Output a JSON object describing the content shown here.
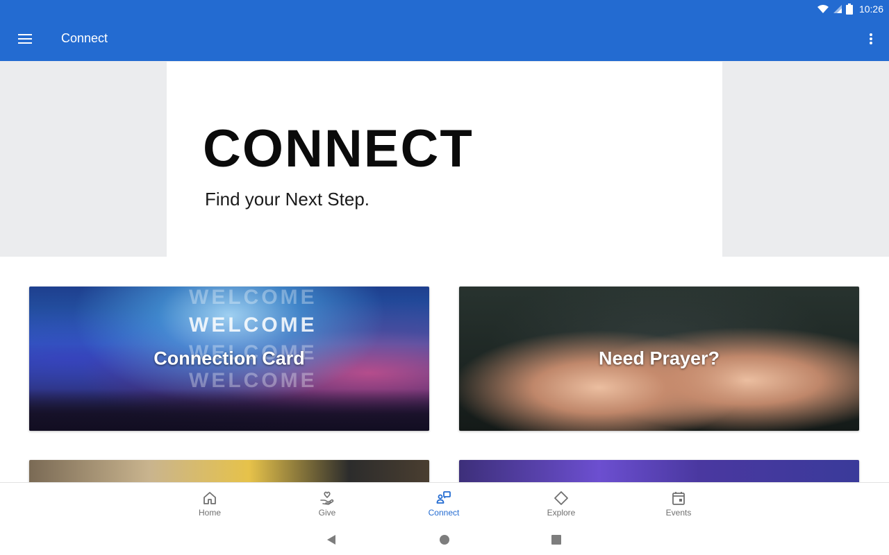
{
  "status_bar": {
    "time": "10:26"
  },
  "app_bar": {
    "title": "Connect"
  },
  "hero": {
    "title": "CONNECT",
    "subtitle": "Find your Next Step."
  },
  "tiles": [
    {
      "label": "Connection Card",
      "image_text": "WELCOME"
    },
    {
      "label": "Need Prayer?"
    }
  ],
  "bottom_nav": {
    "items": [
      {
        "label": "Home",
        "icon": "home-icon"
      },
      {
        "label": "Give",
        "icon": "give-icon"
      },
      {
        "label": "Connect",
        "icon": "connect-icon",
        "active": true
      },
      {
        "label": "Explore",
        "icon": "explore-icon"
      },
      {
        "label": "Events",
        "icon": "calendar-icon"
      }
    ]
  },
  "colors": {
    "primary": "#236bd1",
    "active_nav": "#236bd1",
    "inactive_nav": "#6f6f6f",
    "hero_band": "#ebecee"
  }
}
